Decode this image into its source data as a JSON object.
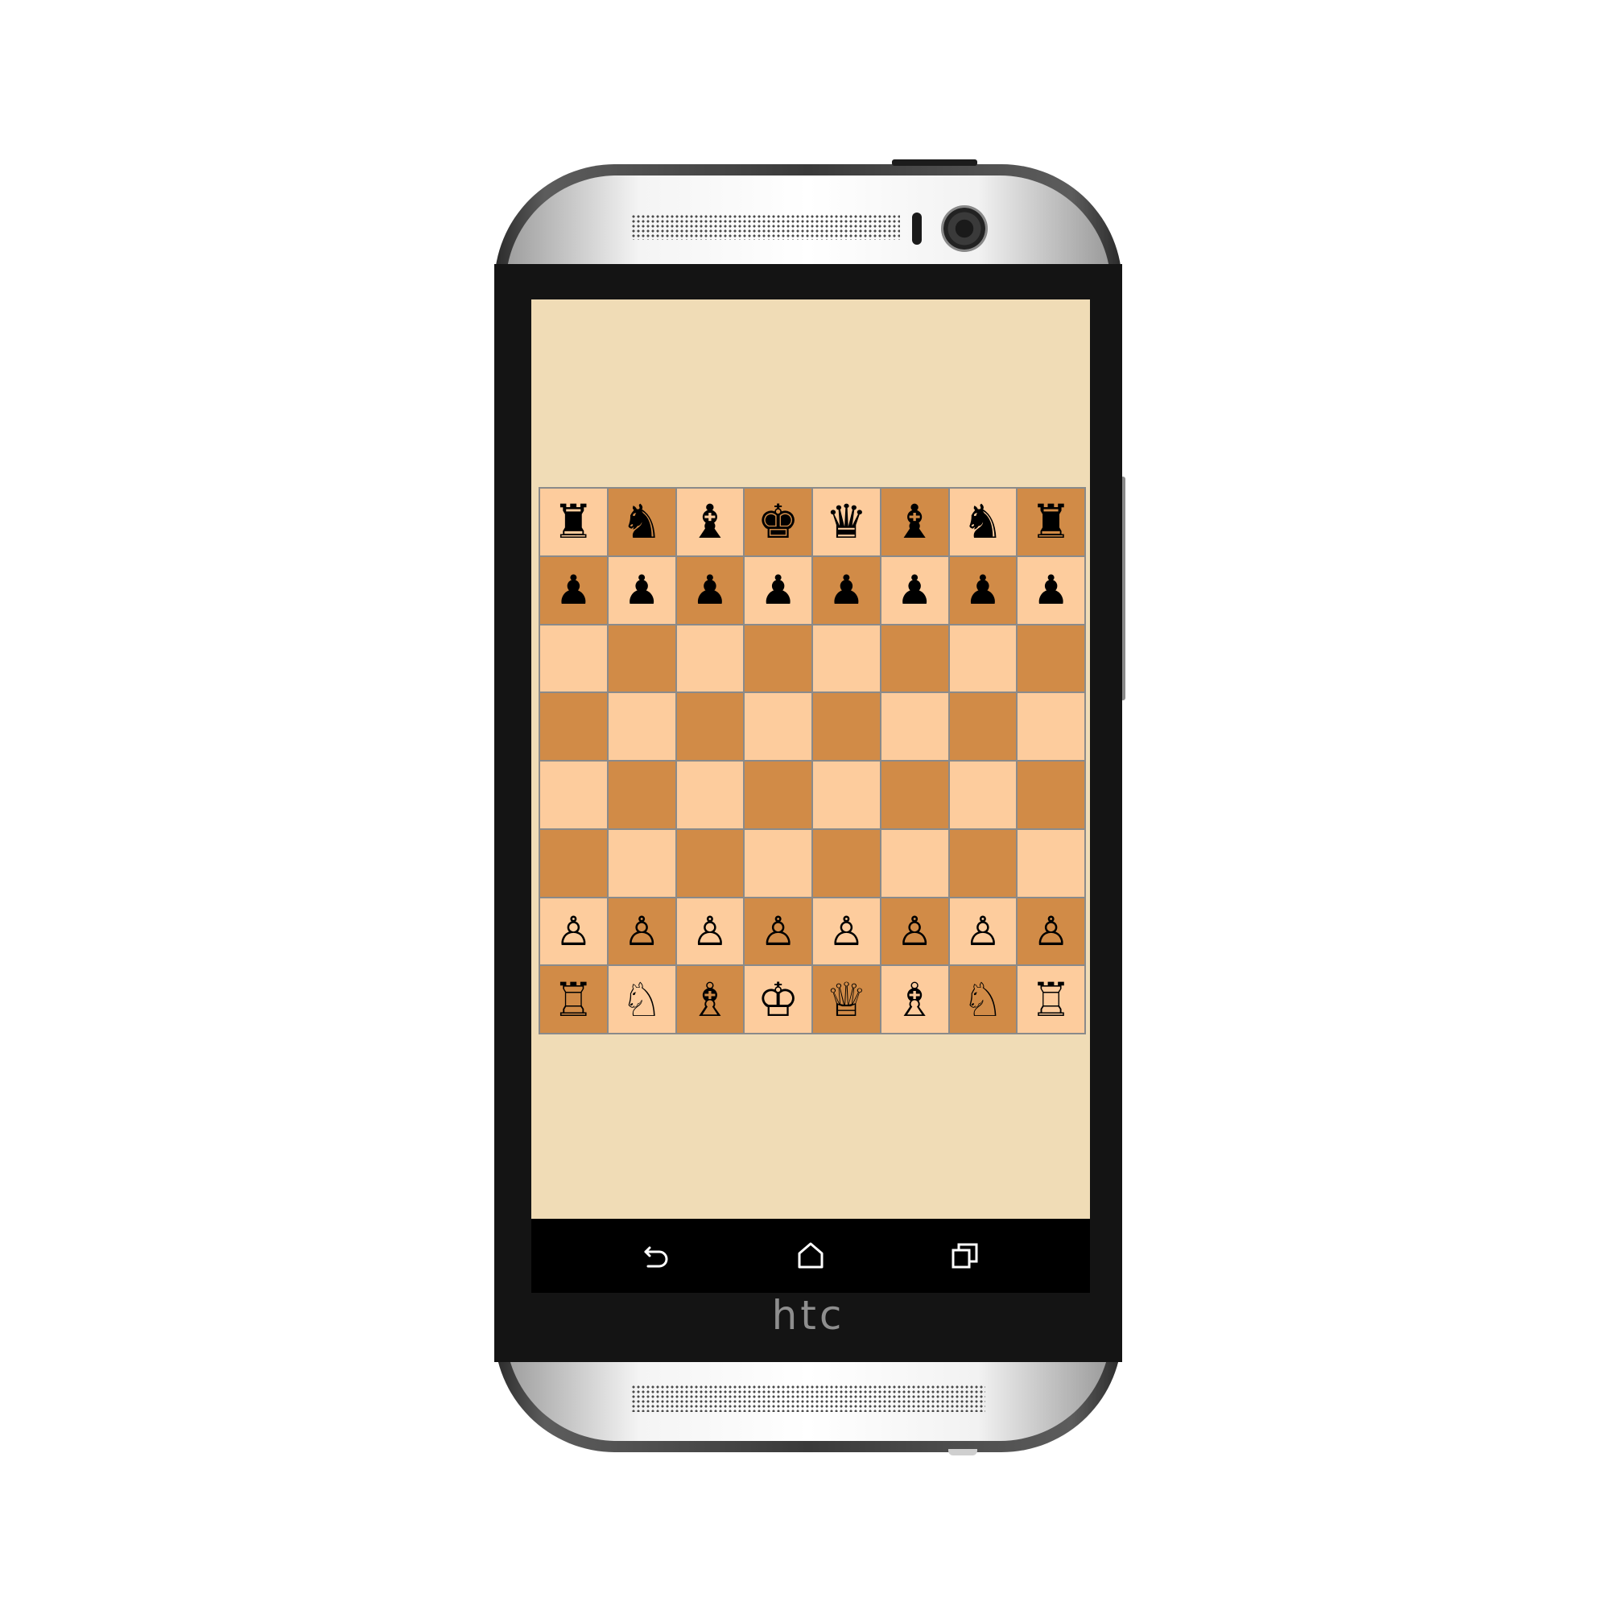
{
  "device": {
    "brand": "htc"
  },
  "board": {
    "light_color": "#fdcc9d",
    "dark_color": "#d18b47",
    "background_color": "#f0dcb6",
    "position": [
      [
        "br",
        "bn",
        "bb",
        "bk",
        "bq",
        "bb",
        "bn",
        "br"
      ],
      [
        "bp",
        "bp",
        "bp",
        "bp",
        "bp",
        "bp",
        "bp",
        "bp"
      ],
      [
        "",
        "",
        "",
        "",
        "",
        "",
        "",
        ""
      ],
      [
        "",
        "",
        "",
        "",
        "",
        "",
        "",
        ""
      ],
      [
        "",
        "",
        "",
        "",
        "",
        "",
        "",
        ""
      ],
      [
        "",
        "",
        "",
        "",
        "",
        "",
        "",
        ""
      ],
      [
        "wp",
        "wp",
        "wp",
        "wp",
        "wp",
        "wp",
        "wp",
        "wp"
      ],
      [
        "wr",
        "wn",
        "wb",
        "wk",
        "wq",
        "wb",
        "wn",
        "wr"
      ]
    ]
  },
  "nav_bar": {
    "back_icon": "back-arrow-icon",
    "home_icon": "home-icon",
    "recents_icon": "recents-icon"
  }
}
